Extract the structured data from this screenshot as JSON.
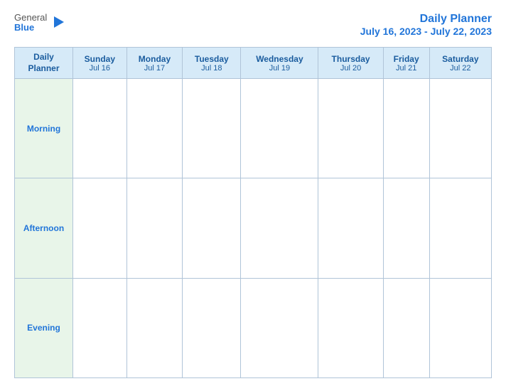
{
  "logo": {
    "general": "General",
    "blue": "Blue"
  },
  "title": {
    "main": "Daily Planner",
    "date_range": "July 16, 2023 - July 22, 2023"
  },
  "table": {
    "header_label": "Daily\nPlanner",
    "columns": [
      {
        "day": "Sunday",
        "date": "Jul 16"
      },
      {
        "day": "Monday",
        "date": "Jul 17"
      },
      {
        "day": "Tuesday",
        "date": "Jul 18"
      },
      {
        "day": "Wednesday",
        "date": "Jul 19"
      },
      {
        "day": "Thursday",
        "date": "Jul 20"
      },
      {
        "day": "Friday",
        "date": "Jul 21"
      },
      {
        "day": "Saturday",
        "date": "Jul 22"
      }
    ],
    "rows": [
      {
        "label": "Morning"
      },
      {
        "label": "Afternoon"
      },
      {
        "label": "Evening"
      }
    ]
  }
}
